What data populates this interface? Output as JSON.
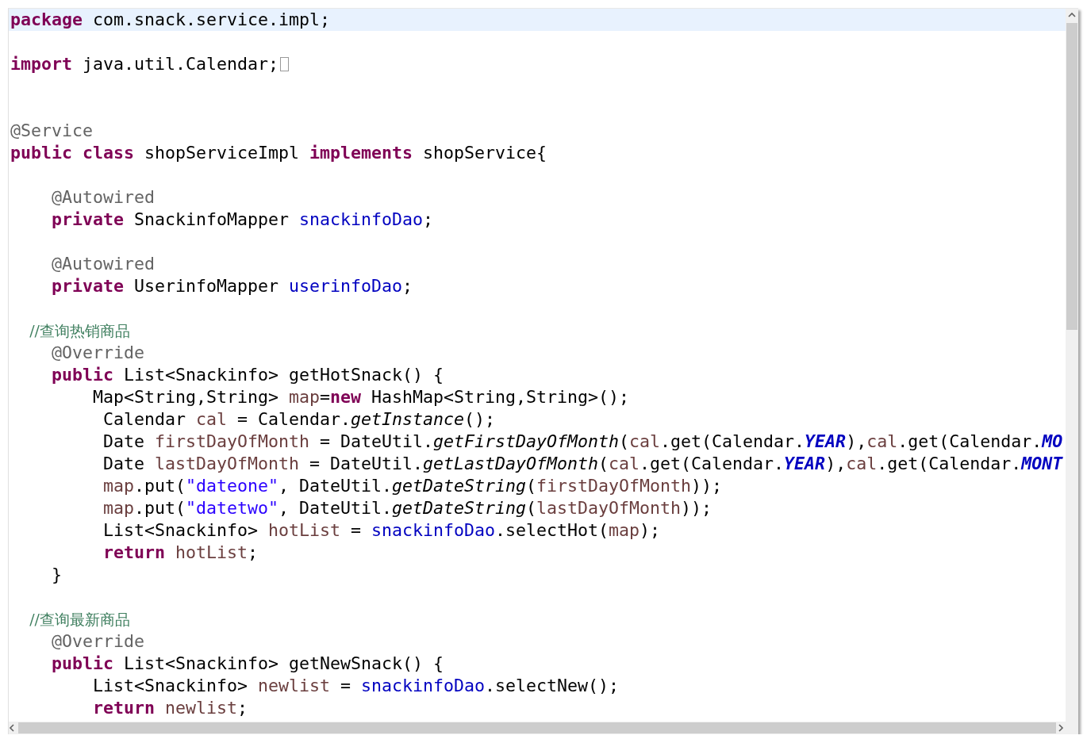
{
  "editor": {
    "lines": [
      {
        "current": true,
        "folded": false,
        "tokens": [
          {
            "kind": "kw",
            "t": "package"
          },
          {
            "kind": "plain",
            "t": " com.snack.service.impl;"
          }
        ]
      },
      {
        "current": false,
        "folded": false
      },
      {
        "current": false,
        "folded": true,
        "tokens": [
          {
            "kind": "kw",
            "t": "import"
          },
          {
            "kind": "plain",
            "t": " java.util.Calendar;"
          }
        ]
      },
      {
        "current": false,
        "folded": false
      },
      {
        "current": false,
        "folded": false
      },
      {
        "current": false,
        "folded": false,
        "tokens": [
          {
            "kind": "ann",
            "t": "@Service"
          }
        ]
      },
      {
        "current": false,
        "folded": false,
        "tokens": [
          {
            "kind": "kw",
            "t": "public"
          },
          {
            "kind": "kw",
            "t": " class"
          },
          {
            "kind": "plain",
            "t": " shopServiceImpl "
          },
          {
            "kind": "kw",
            "t": "implements"
          },
          {
            "kind": "plain",
            "t": " shopService{"
          }
        ]
      },
      {
        "current": false,
        "folded": false
      },
      {
        "current": false,
        "folded": false,
        "tokens": [
          {
            "kind": "ann",
            "t": "    @Autowired"
          }
        ]
      },
      {
        "current": false,
        "folded": false,
        "tokens": [
          {
            "kind": "kw",
            "t": "    private"
          },
          {
            "kind": "plain",
            "t": " SnackinfoMapper "
          },
          {
            "kind": "field",
            "t": "snackinfoDao"
          },
          {
            "kind": "plain",
            "t": ";"
          }
        ]
      },
      {
        "current": false,
        "folded": false
      },
      {
        "current": false,
        "folded": false,
        "tokens": [
          {
            "kind": "ann",
            "t": "    @Autowired"
          }
        ]
      },
      {
        "current": false,
        "folded": false,
        "tokens": [
          {
            "kind": "kw",
            "t": "    private"
          },
          {
            "kind": "plain",
            "t": " UserinfoMapper "
          },
          {
            "kind": "field",
            "t": "userinfoDao"
          },
          {
            "kind": "plain",
            "t": ";"
          }
        ]
      },
      {
        "current": false,
        "folded": false
      },
      {
        "current": false,
        "folded": false,
        "tokens": [
          {
            "kind": "comment",
            "t": "    //查询热销商品"
          }
        ]
      },
      {
        "current": false,
        "folded": false,
        "tokens": [
          {
            "kind": "ann",
            "t": "    @Override"
          }
        ]
      },
      {
        "current": false,
        "folded": false,
        "tokens": [
          {
            "kind": "kw",
            "t": "    public"
          },
          {
            "kind": "plain",
            "t": " List<Snackinfo> getHotSnack() {"
          }
        ]
      },
      {
        "current": false,
        "folded": false,
        "tokens": [
          {
            "kind": "plain",
            "t": "        Map<String,String> "
          },
          {
            "kind": "local",
            "t": "map"
          },
          {
            "kind": "plain",
            "t": "="
          },
          {
            "kind": "kw",
            "t": "new"
          },
          {
            "kind": "plain",
            "t": " HashMap<String,String>();"
          }
        ]
      },
      {
        "current": false,
        "folded": false,
        "tokens": [
          {
            "kind": "plain",
            "t": "         Calendar "
          },
          {
            "kind": "local",
            "t": "cal"
          },
          {
            "kind": "plain",
            "t": " = Calendar."
          },
          {
            "kind": "italic",
            "t": "getInstance"
          },
          {
            "kind": "plain",
            "t": "();"
          }
        ]
      },
      {
        "current": false,
        "folded": false,
        "tokens": [
          {
            "kind": "plain",
            "t": "         Date "
          },
          {
            "kind": "local",
            "t": "firstDayOfMonth"
          },
          {
            "kind": "plain",
            "t": " = DateUtil."
          },
          {
            "kind": "italic",
            "t": "getFirstDayOfMonth"
          },
          {
            "kind": "plain",
            "t": "("
          },
          {
            "kind": "local",
            "t": "cal"
          },
          {
            "kind": "plain",
            "t": ".get(Calendar."
          },
          {
            "kind": "static",
            "t": "YEAR"
          },
          {
            "kind": "plain",
            "t": "),"
          },
          {
            "kind": "local",
            "t": "cal"
          },
          {
            "kind": "plain",
            "t": ".get(Calendar."
          },
          {
            "kind": "static",
            "t": "MO"
          }
        ]
      },
      {
        "current": false,
        "folded": false,
        "tokens": [
          {
            "kind": "plain",
            "t": "         Date "
          },
          {
            "kind": "local",
            "t": "lastDayOfMonth"
          },
          {
            "kind": "plain",
            "t": " = DateUtil."
          },
          {
            "kind": "italic",
            "t": "getLastDayOfMonth"
          },
          {
            "kind": "plain",
            "t": "("
          },
          {
            "kind": "local",
            "t": "cal"
          },
          {
            "kind": "plain",
            "t": ".get(Calendar."
          },
          {
            "kind": "static",
            "t": "YEAR"
          },
          {
            "kind": "plain",
            "t": "),"
          },
          {
            "kind": "local",
            "t": "cal"
          },
          {
            "kind": "plain",
            "t": ".get(Calendar."
          },
          {
            "kind": "static",
            "t": "MONT"
          }
        ]
      },
      {
        "current": false,
        "folded": false,
        "tokens": [
          {
            "kind": "local",
            "t": "         map"
          },
          {
            "kind": "plain",
            "t": ".put("
          },
          {
            "kind": "str",
            "t": "\"dateone\""
          },
          {
            "kind": "plain",
            "t": ", DateUtil."
          },
          {
            "kind": "italic",
            "t": "getDateString"
          },
          {
            "kind": "plain",
            "t": "("
          },
          {
            "kind": "local",
            "t": "firstDayOfMonth"
          },
          {
            "kind": "plain",
            "t": "));"
          }
        ]
      },
      {
        "current": false,
        "folded": false,
        "tokens": [
          {
            "kind": "local",
            "t": "         map"
          },
          {
            "kind": "plain",
            "t": ".put("
          },
          {
            "kind": "str",
            "t": "\"datetwo\""
          },
          {
            "kind": "plain",
            "t": ", DateUtil."
          },
          {
            "kind": "italic",
            "t": "getDateString"
          },
          {
            "kind": "plain",
            "t": "("
          },
          {
            "kind": "local",
            "t": "lastDayOfMonth"
          },
          {
            "kind": "plain",
            "t": "));"
          }
        ]
      },
      {
        "current": false,
        "folded": false,
        "tokens": [
          {
            "kind": "plain",
            "t": "         List<Snackinfo> "
          },
          {
            "kind": "local",
            "t": "hotList"
          },
          {
            "kind": "plain",
            "t": " = "
          },
          {
            "kind": "field",
            "t": "snackinfoDao"
          },
          {
            "kind": "plain",
            "t": ".selectHot("
          },
          {
            "kind": "local",
            "t": "map"
          },
          {
            "kind": "plain",
            "t": ");"
          }
        ]
      },
      {
        "current": false,
        "folded": false,
        "tokens": [
          {
            "kind": "kw",
            "t": "         return"
          },
          {
            "kind": "local",
            "t": " hotList"
          },
          {
            "kind": "plain",
            "t": ";"
          }
        ]
      },
      {
        "current": false,
        "folded": false,
        "tokens": [
          {
            "kind": "plain",
            "t": "    }"
          }
        ]
      },
      {
        "current": false,
        "folded": false
      },
      {
        "current": false,
        "folded": false,
        "tokens": [
          {
            "kind": "comment",
            "t": "    //查询最新商品"
          }
        ]
      },
      {
        "current": false,
        "folded": false,
        "tokens": [
          {
            "kind": "ann",
            "t": "    @Override"
          }
        ]
      },
      {
        "current": false,
        "folded": false,
        "tokens": [
          {
            "kind": "kw",
            "t": "    public"
          },
          {
            "kind": "plain",
            "t": " List<Snackinfo> getNewSnack() {"
          }
        ]
      },
      {
        "current": false,
        "folded": false,
        "tokens": [
          {
            "kind": "plain",
            "t": "        List<Snackinfo> "
          },
          {
            "kind": "local",
            "t": "newlist"
          },
          {
            "kind": "plain",
            "t": " = "
          },
          {
            "kind": "field",
            "t": "snackinfoDao"
          },
          {
            "kind": "plain",
            "t": ".selectNew();"
          }
        ]
      },
      {
        "current": false,
        "folded": false,
        "tokens": [
          {
            "kind": "kw",
            "t": "        return"
          },
          {
            "kind": "local",
            "t": " newlist"
          },
          {
            "kind": "plain",
            "t": ";"
          }
        ]
      }
    ]
  }
}
